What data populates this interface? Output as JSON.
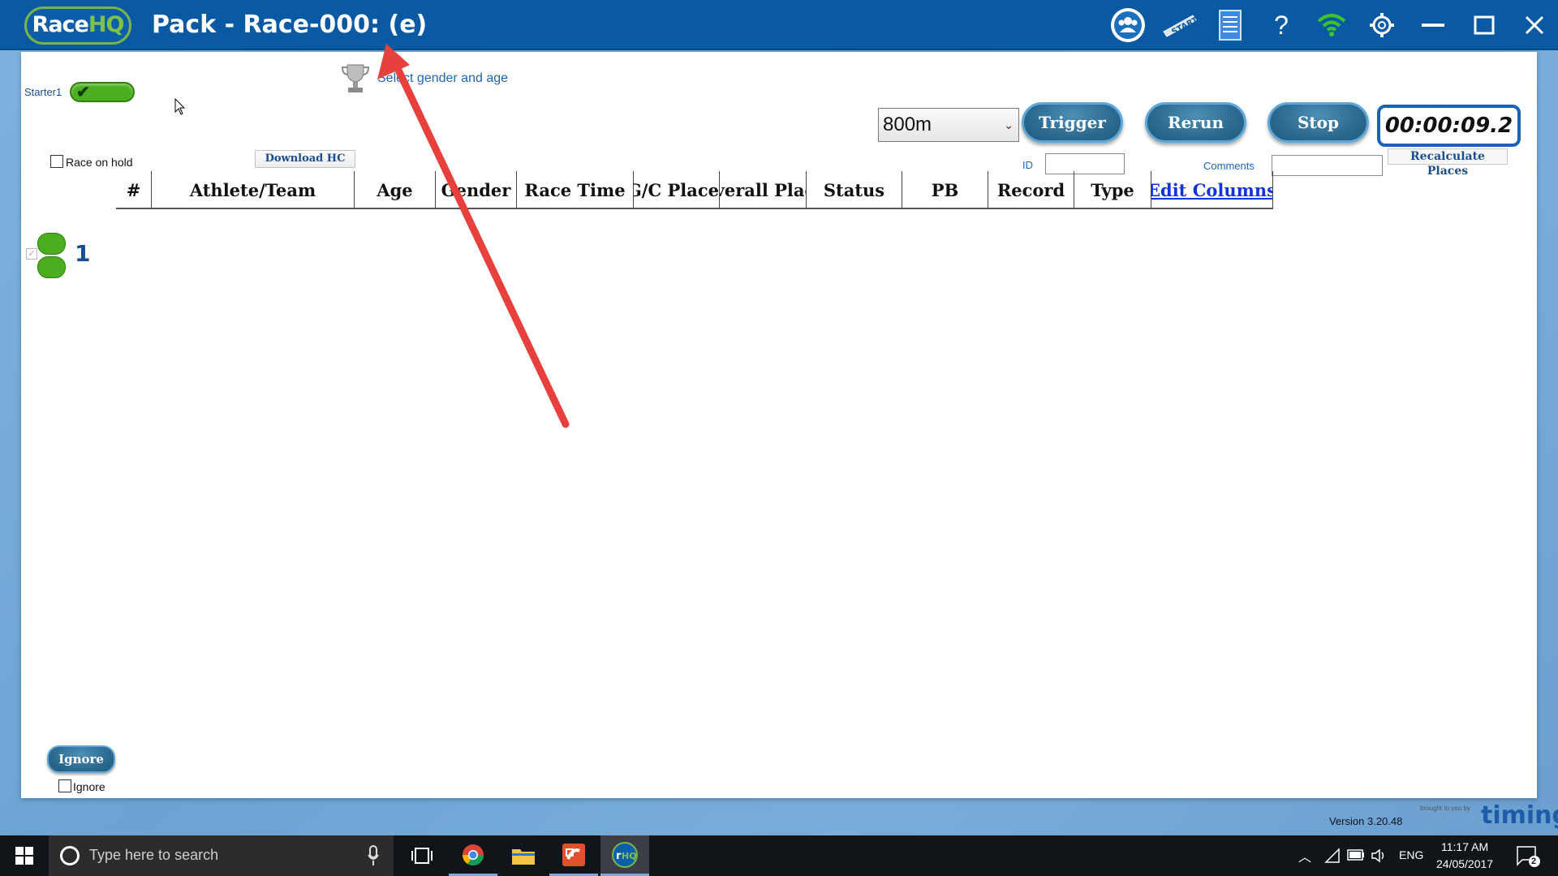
{
  "window": {
    "logo": {
      "race": "Race",
      "hq": "HQ"
    },
    "title": "Pack - Race-000: (e)",
    "toolbar_icons": [
      "team-icon",
      "start-icon",
      "list-icon",
      "help-icon",
      "wifi-icon",
      "settings-icon",
      "minimize-icon",
      "maximize-icon",
      "close-icon"
    ],
    "help_glyph": "?"
  },
  "starter": {
    "label": "Starter1",
    "status_color": "#4caf1f"
  },
  "header_controls": {
    "select_gender_link": "Select gender and age",
    "distance": {
      "selected": "800m"
    },
    "trigger_label": "Trigger",
    "rerun_label": "Rerun",
    "stop_label": "Stop",
    "timer": "00:00:09.2",
    "recalculate_label": "Recalculate Places",
    "race_on_hold_label": "Race on hold",
    "download_hc_label": "Download HC",
    "id_label": "ID",
    "comments_label": "Comments"
  },
  "table": {
    "columns": [
      "#",
      "Athlete/Team",
      "Age",
      "Gender",
      "Race Time",
      "A/G/C Place",
      "Overall Place",
      "Status",
      "PB",
      "Record",
      "Type"
    ],
    "edit_columns_label": "Edit Columns"
  },
  "lanes": [
    {
      "number": "1"
    }
  ],
  "footer": {
    "ignore_button": "Ignore",
    "ignore_checkbox_label": "Ignore",
    "version": "Version 3.20.48",
    "brand": "timing",
    "brand_small": "brought to you by"
  },
  "taskbar": {
    "search_placeholder": "Type here to search",
    "lang": "ENG",
    "time": "11:17 AM",
    "date": "24/05/2017",
    "notifications": "2"
  },
  "colors": {
    "titlebar": "#0a5aa3",
    "accent_green": "#4bae1e",
    "button_blue": "#2c6a90",
    "link_blue": "#1133dd"
  }
}
